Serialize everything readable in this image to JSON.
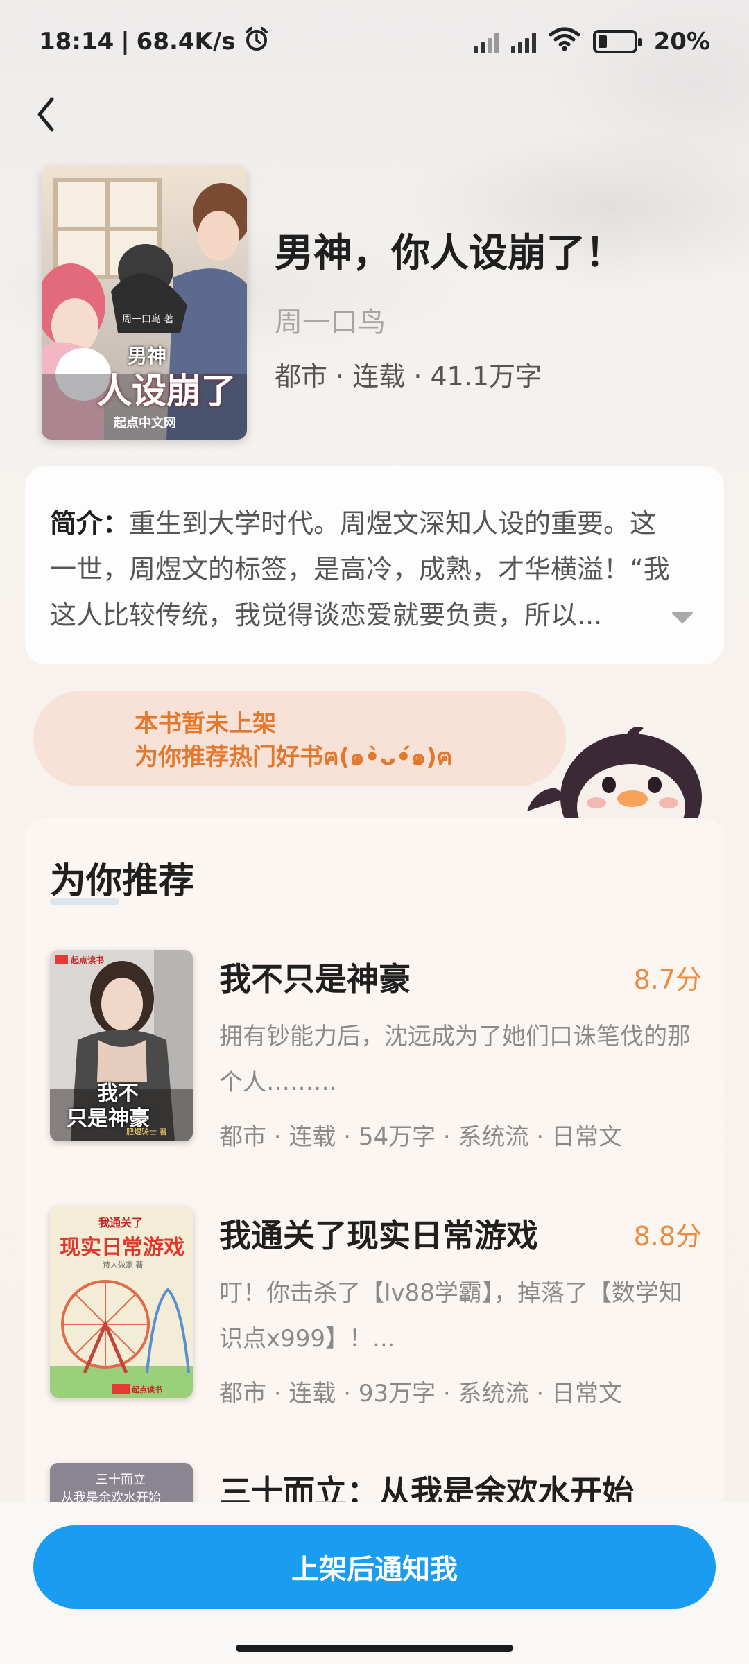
{
  "status_bar": {
    "time": "18:14",
    "speed": "68.4K/s",
    "battery": "20%"
  },
  "book": {
    "title": "男神，你人设崩了！",
    "author": "周一口鸟",
    "meta": "都市 · 连载 · 41.1万字",
    "cover_author": "周一口鸟 著",
    "cover_title_top": "男神",
    "cover_title_main": "人设崩了",
    "cover_publisher": "起点中文网"
  },
  "intro": {
    "label": "简介：",
    "text": "重生到大学时代。周煜文深知人设的重要。这一世，周煜文的标签，是高冷，成熟，才华横溢！“我这人比较传统，我觉得谈恋爱就要负责，所以..."
  },
  "notice": {
    "line1": "本书暂未上架",
    "line2": "为你推荐热门好书ฅ(๑•̀ᴗ•́๑)ฅ"
  },
  "recommendations": {
    "heading": "为你推荐",
    "items": [
      {
        "title": "我不只是神豪",
        "score": "8.7分",
        "desc": "拥有钞能力后，沈远成为了她们口诛笔伐的那个人………",
        "tags": "都市 · 连载 · 54万字 · 系统流 · 日常文",
        "cover_brand": "起点读书",
        "cover_line1": "我不",
        "cover_line2": "只是神豪",
        "cover_author": "肥煜骑士 著"
      },
      {
        "title": "我通关了现实日常游戏",
        "score": "8.8分",
        "desc": "叮！你击杀了【lv88学霸】，掉落了【数学知识点x999】！...",
        "tags": "都市 · 连载 · 93万字 · 系统流 · 日常文",
        "cover_line1": "我通关了",
        "cover_line2": "现实日常游戏",
        "cover_author": "诗人做家 著",
        "cover_brand": "起点读书"
      },
      {
        "title": "三十而立：从我是余欢水开始",
        "cover_line1": "三十而立",
        "cover_line2": "从我是余欢水开始"
      }
    ]
  },
  "bottom": {
    "notify_label": "上架后通知我"
  },
  "colors": {
    "accent_blue": "#1a9cf0",
    "score_orange": "#ec8a3e",
    "notice_orange": "#e2782e",
    "notice_bg": "#f8e2d8"
  }
}
